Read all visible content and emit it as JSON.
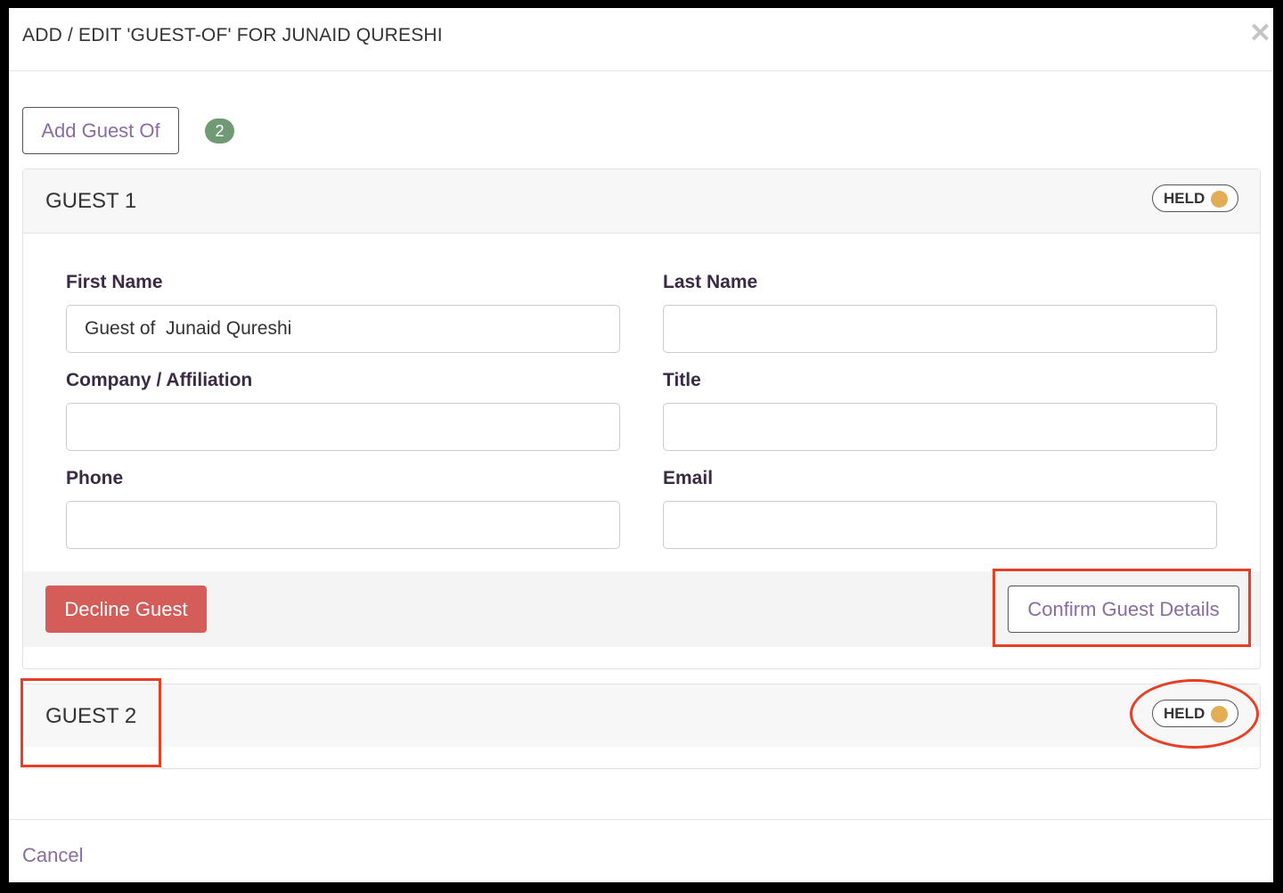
{
  "modal": {
    "title": "ADD / EDIT 'GUEST-OF' FOR JUNAID QURESHI",
    "close_icon": "close-icon"
  },
  "toolbar": {
    "add_label": "Add Guest Of",
    "guest_count": "2"
  },
  "guests": [
    {
      "title": "GUEST 1",
      "status": "HELD",
      "fields": {
        "first_name": {
          "label": "First Name",
          "value": "Guest of  Junaid Qureshi"
        },
        "last_name": {
          "label": "Last Name",
          "value": ""
        },
        "company": {
          "label": "Company / Affiliation",
          "value": ""
        },
        "title": {
          "label": "Title",
          "value": ""
        },
        "phone": {
          "label": "Phone",
          "value": ""
        },
        "email": {
          "label": "Email",
          "value": ""
        }
      },
      "decline_label": "Decline Guest",
      "confirm_label": "Confirm Guest Details"
    },
    {
      "title": "GUEST 2",
      "status": "HELD"
    }
  ],
  "footer": {
    "cancel_label": "Cancel"
  },
  "colors": {
    "accent": "#8a6ca0",
    "danger": "#d45d5a",
    "badge": "#6f9a74",
    "held_dot": "#e3ad55",
    "annotation": "#e63f26"
  }
}
